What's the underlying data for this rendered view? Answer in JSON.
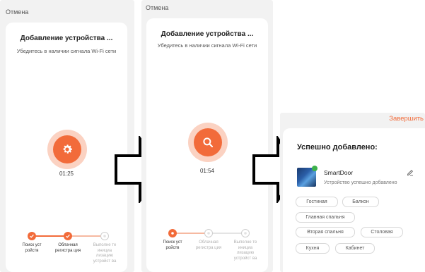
{
  "screen1": {
    "cancel_label": "Отмена",
    "title": "Добавление устройства ...",
    "subtitle": "Убедитесь в наличии сигнала Wi-Fi сети",
    "timer": "01:25",
    "icon": "gear-icon",
    "steps": [
      {
        "label": "Поиск уст ройств",
        "state": "done"
      },
      {
        "label": "Облачная регистра ция",
        "state": "done"
      },
      {
        "label": "Выполне те инициа лизацию устройст ва",
        "state": "pending"
      }
    ]
  },
  "screen2": {
    "cancel_label": "Отмена",
    "title": "Добавление устройства ...",
    "subtitle": "Убедитесь в наличии сигнала Wi-Fi сети",
    "timer": "01:54",
    "icon": "search-icon",
    "steps": [
      {
        "label": "Поиск уст ройств",
        "state": "active"
      },
      {
        "label": "Облачная регистра ция",
        "state": "pending"
      },
      {
        "label": "Выполне те инициа лизацию устройст ва",
        "state": "pending"
      }
    ]
  },
  "screen3": {
    "finish_label": "Завершить",
    "title": "Успешно добавлено:",
    "device": {
      "name": "SmartDoor",
      "status": "Устройство успешно добавлено"
    },
    "rooms": [
      "Гостиная",
      "Балкон",
      "Главная спальня",
      "Вторая спальня",
      "Столовая",
      "Кухня",
      "Кабинет"
    ]
  },
  "colors": {
    "accent": "#f26b3a",
    "accent_light": "#fbd2c2",
    "success": "#3db24a"
  }
}
